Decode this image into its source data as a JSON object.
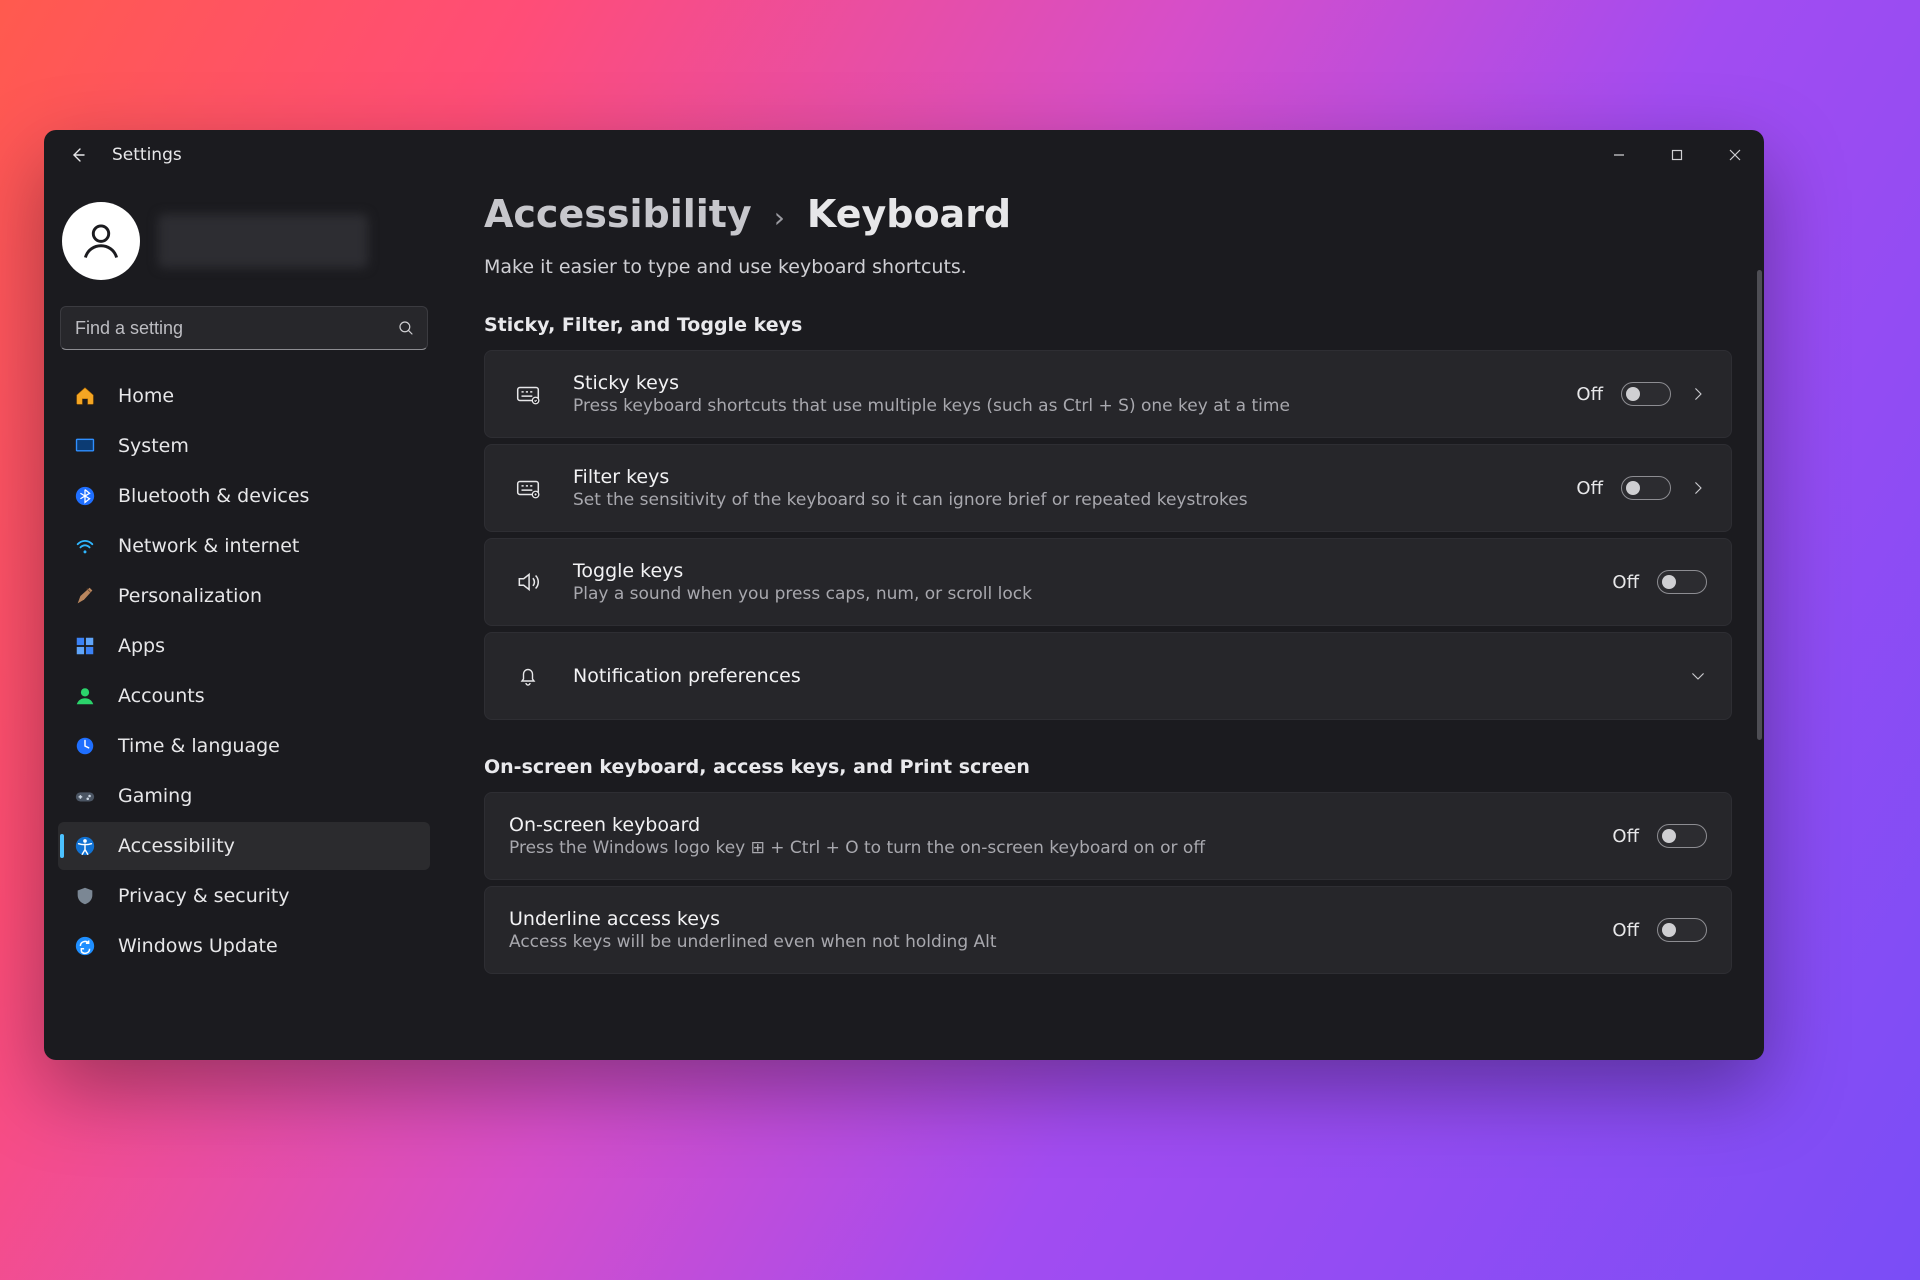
{
  "titlebar": {
    "title": "Settings"
  },
  "search": {
    "placeholder": "Find a setting"
  },
  "sidebar": {
    "items": [
      {
        "label": "Home",
        "icon": "home"
      },
      {
        "label": "System",
        "icon": "system"
      },
      {
        "label": "Bluetooth & devices",
        "icon": "bluetooth"
      },
      {
        "label": "Network & internet",
        "icon": "network"
      },
      {
        "label": "Personalization",
        "icon": "personalization"
      },
      {
        "label": "Apps",
        "icon": "apps"
      },
      {
        "label": "Accounts",
        "icon": "accounts"
      },
      {
        "label": "Time & language",
        "icon": "time"
      },
      {
        "label": "Gaming",
        "icon": "gaming"
      },
      {
        "label": "Accessibility",
        "icon": "accessibility",
        "active": true
      },
      {
        "label": "Privacy & security",
        "icon": "privacy"
      },
      {
        "label": "Windows Update",
        "icon": "update"
      }
    ]
  },
  "breadcrumb": {
    "parent": "Accessibility",
    "current": "Keyboard"
  },
  "subtitle": "Make it easier to type and use keyboard shortcuts.",
  "sections": [
    {
      "title": "Sticky, Filter, and Toggle keys",
      "items": [
        {
          "icon": "keyboard-sticky",
          "title": "Sticky keys",
          "desc": "Press keyboard shortcuts that use multiple keys (such as Ctrl + S) one key at a time",
          "toggle": "Off",
          "chevron": true
        },
        {
          "icon": "keyboard-filter",
          "title": "Filter keys",
          "desc": "Set the sensitivity of the keyboard so it can ignore brief or repeated keystrokes",
          "toggle": "Off",
          "chevron": true
        },
        {
          "icon": "sound",
          "title": "Toggle keys",
          "desc": "Play a sound when you press caps, num, or scroll lock",
          "toggle": "Off",
          "chevron": false
        },
        {
          "icon": "bell",
          "title": "Notification preferences",
          "desc": "",
          "toggle": null,
          "chevronDown": true
        }
      ]
    },
    {
      "title": "On-screen keyboard, access keys, and Print screen",
      "items": [
        {
          "icon": null,
          "title": "On-screen keyboard",
          "desc": "Press the Windows logo key ⊞ + Ctrl + O to turn the on-screen keyboard on or off",
          "toggle": "Off"
        },
        {
          "icon": null,
          "title": "Underline access keys",
          "desc": "Access keys will be underlined even when not holding Alt",
          "toggle": "Off"
        }
      ]
    }
  ]
}
